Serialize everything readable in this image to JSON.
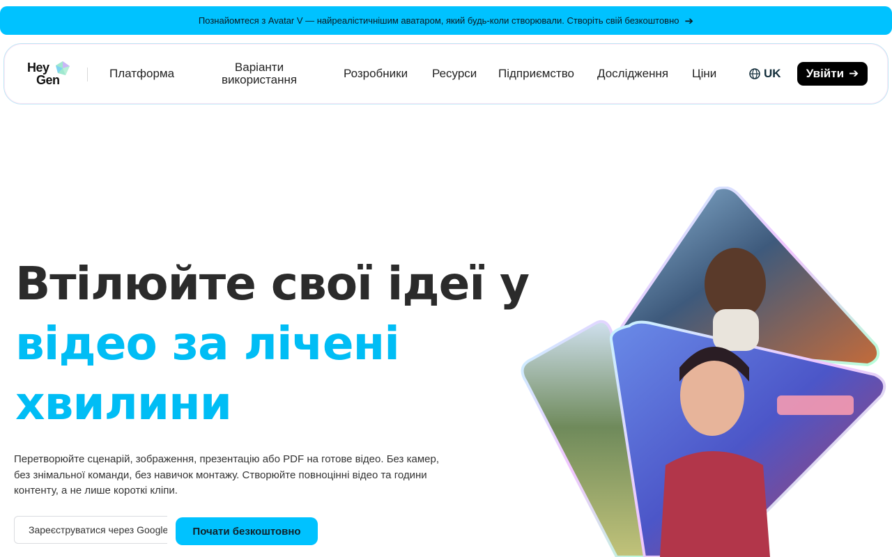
{
  "announcement": {
    "text": "Познайомтеся з Avatar V — найреалістичнішим аватаром, який будь-коли створювали. Створіть свій безкоштовно",
    "arrow_icon": "arrow-right-icon",
    "color": "#00c2ff"
  },
  "logo": {
    "line1": "Hey",
    "line2": "Gen"
  },
  "nav": {
    "items": [
      {
        "label": "Платформа"
      },
      {
        "label": "Варіанти використання"
      },
      {
        "label": "Розробники"
      },
      {
        "label": "Ресурси"
      },
      {
        "label": "Підприємство"
      },
      {
        "label": "Дослідження"
      },
      {
        "label": "Ціни"
      }
    ],
    "lang": {
      "icon": "globe-icon",
      "label": "UK"
    },
    "login": {
      "label": "Увійти",
      "icon": "arrow-right-icon"
    }
  },
  "hero": {
    "title_dark": "Втілюйте свої ідеї у",
    "title_blue_1": "відео за лічені",
    "title_blue_2": "хвилини",
    "subtitle": "Перетворюйте сценарій, зображення, презентацію або PDF на готове відео. Без камер, без знімальної команди, без навичок монтажу. Створюйте повноцінні відео та години контенту, а не лише короткі кліпи.",
    "google_button": "Зареєструватися через Google",
    "cta_button": "Почати безкоштовно",
    "accent_color": "#00bdf5"
  }
}
